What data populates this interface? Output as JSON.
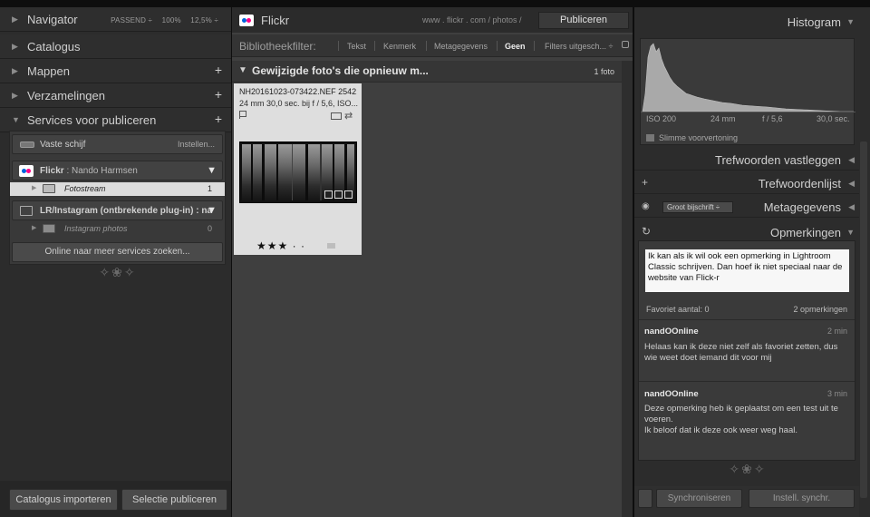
{
  "left": {
    "navigator": {
      "label": "Navigator",
      "opts": [
        "PASSEND ÷",
        "100%",
        "12,5% ÷"
      ]
    },
    "sections": [
      "Catalogus",
      "Mappen",
      "Verzamelingen",
      "Services voor publiceren"
    ],
    "services": {
      "vaste_schijf": {
        "label": "Vaste schijf",
        "action": "Instellen..."
      },
      "flickr": {
        "label": "Flickr",
        "account": ": Nando Harmsen"
      },
      "fotostream": {
        "label": "Fotostream",
        "count": "1"
      },
      "lr_instagram": {
        "label": "LR/Instagram (ontbrekende plug-in)",
        "suffix": ": na"
      },
      "instagram_photos": {
        "label": "Instagram photos",
        "count": "0"
      },
      "search_more": "Online naar meer services zoeken..."
    },
    "ornament": "✧❀✧",
    "buttons": {
      "import": "Catalogus importeren",
      "publish": "Selectie publiceren"
    }
  },
  "center": {
    "title": "Flickr",
    "url": "www . flickr . com / photos /",
    "publish_button": "Publiceren",
    "filter": {
      "label": "Bibliotheekfilter:",
      "options": [
        "Tekst",
        "Kenmerk",
        "Metagegevens",
        "Geen",
        "Filters uitgesch...  ÷"
      ],
      "active": "Geen"
    },
    "section": {
      "title": "Gewijzigde foto's die opnieuw m...",
      "count": "1 foto"
    },
    "photo": {
      "filename": "NH20161023-073422.NEF   2542...",
      "info": "24 mm    30,0 sec. bij f / 5,6, ISO...",
      "stars": "★★★ · ·"
    }
  },
  "right": {
    "histogram": {
      "title": "Histogram",
      "labels": [
        "ISO 200",
        "24 mm",
        "f / 5,6",
        "30,0 sec."
      ],
      "smart_preview": "Slimme voorvertoning"
    },
    "sections": {
      "keywording": "Trefwoorden vastleggen",
      "keyword_list": "Trefwoordenlijst",
      "metadata": "Metagegevens",
      "comments": "Opmerkingen"
    },
    "metadata_preset": "Groot bijschrift ÷",
    "comment_input": "Ik kan als ik wil ook een opmerking in Lightroom Classic schrijven. Dan hoef ik niet speciaal naar de website van Flick-r",
    "favorites": "Favoriet aantal: 0",
    "comment_count": "2 opmerkingen",
    "comments": [
      {
        "author": "nandOOnline",
        "time": "2 min",
        "text": "Helaas kan ik deze niet zelf als favoriet zetten, dus wie weet doet iemand dit voor mij"
      },
      {
        "author": "nandOOnline",
        "time": "3 min",
        "text": "Deze opmerking heb ik geplaatst om een test uit te voeren.\nIk beloof dat ik deze ook weer weg haal."
      }
    ],
    "buttons": {
      "sync": "Synchroniseren",
      "sync_settings": "Instell. synchr."
    }
  }
}
